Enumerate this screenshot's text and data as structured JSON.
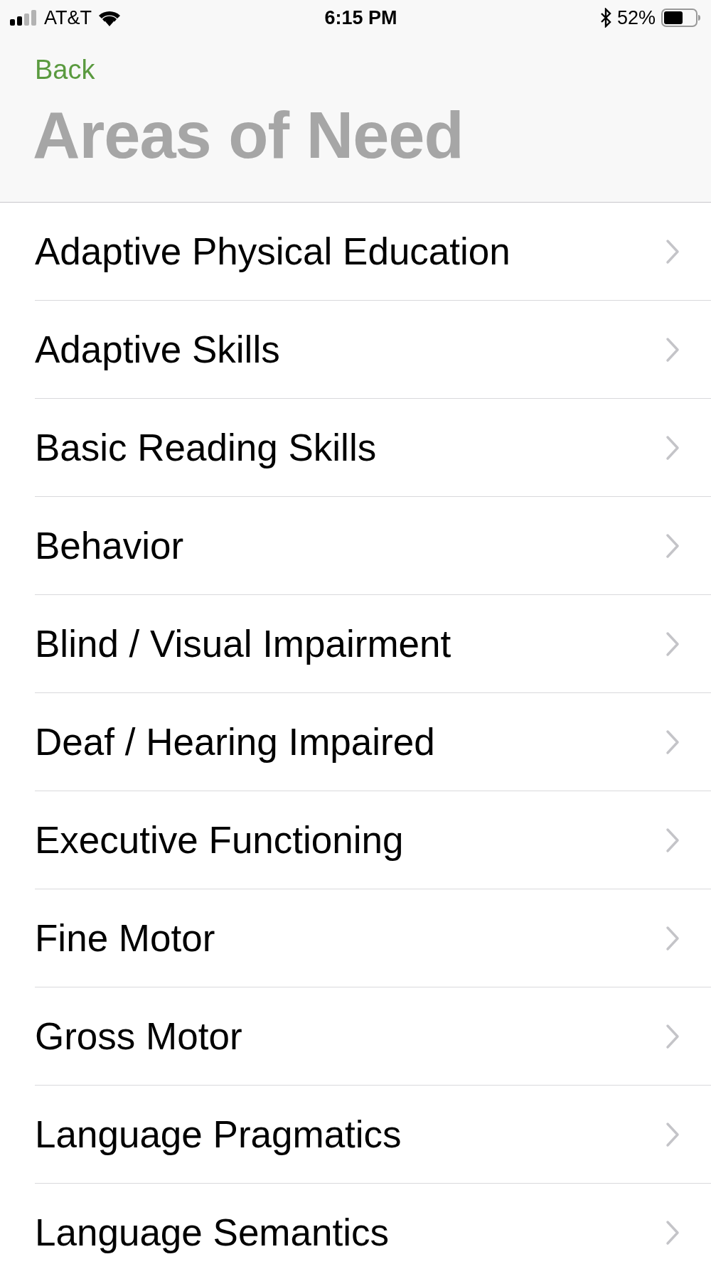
{
  "status_bar": {
    "carrier": "AT&T",
    "time": "6:15 PM",
    "battery": "52%"
  },
  "nav": {
    "back": "Back",
    "title": "Areas of Need"
  },
  "items": [
    {
      "label": "Adaptive Physical Education"
    },
    {
      "label": "Adaptive Skills"
    },
    {
      "label": "Basic Reading Skills"
    },
    {
      "label": "Behavior"
    },
    {
      "label": "Blind / Visual Impairment"
    },
    {
      "label": "Deaf / Hearing Impaired"
    },
    {
      "label": "Executive Functioning"
    },
    {
      "label": "Fine Motor"
    },
    {
      "label": "Gross Motor"
    },
    {
      "label": "Language Pragmatics"
    },
    {
      "label": "Language Semantics"
    }
  ]
}
